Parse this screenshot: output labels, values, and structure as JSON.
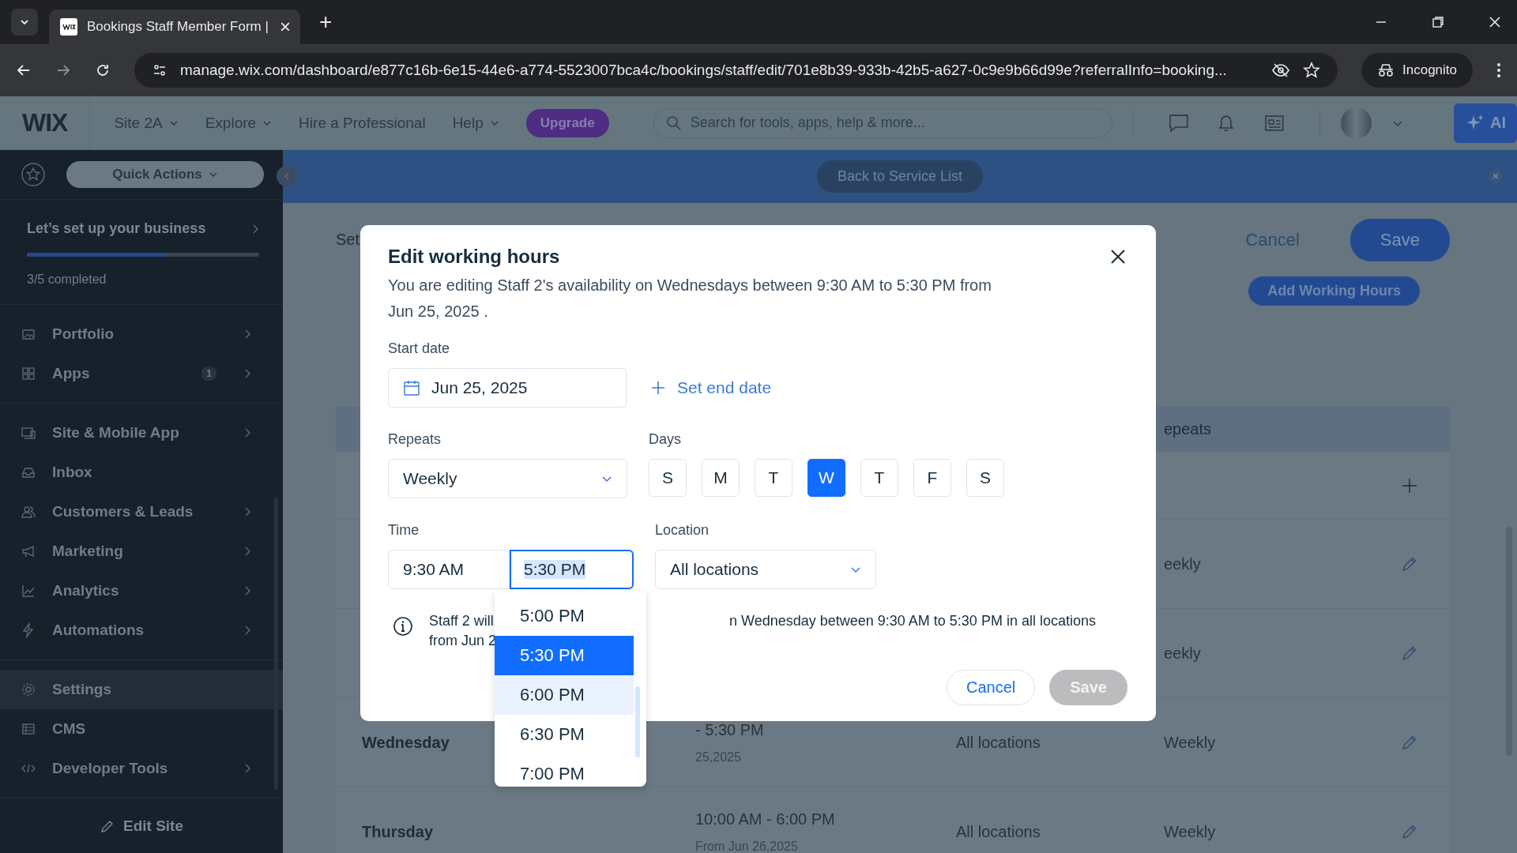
{
  "browser": {
    "tab": {
      "title": "Bookings Staff Member Form |",
      "close": "×"
    },
    "new_tab": "+",
    "url": "manage.wix.com/dashboard/e877c16b-6e15-44e6-a774-5523007bca4c/bookings/staff/edit/701e8b39-933b-42b5-a627-0c9e9b66d99e?referralInfo=booking...",
    "profile": "Incognito"
  },
  "topbar": {
    "logo": "WIX",
    "nav": [
      {
        "label": "Site 2A",
        "dropdown": true
      },
      {
        "label": "Explore",
        "dropdown": true
      },
      {
        "label": "Hire a Professional",
        "dropdown": false
      },
      {
        "label": "Help",
        "dropdown": true
      }
    ],
    "upgrade": "Upgrade",
    "search_placeholder": "Search for tools, apps, help & more...",
    "ai": "AI"
  },
  "sidebar": {
    "quick_actions": "Quick Actions",
    "setup": {
      "title": "Let’s set up your business",
      "progress": "3/5 completed",
      "level": 0.6
    },
    "sections": [
      {
        "items": [
          {
            "label": "Portfolio",
            "arrow": true,
            "selected": false
          },
          {
            "label": "Apps",
            "badge": "1",
            "arrow": true,
            "selected": false
          }
        ]
      },
      {
        "items": [
          {
            "label": "Site & Mobile App",
            "arrow": true,
            "selected": false
          },
          {
            "label": "Inbox",
            "arrow": false,
            "selected": false
          },
          {
            "label": "Customers & Leads",
            "arrow": true,
            "selected": false
          },
          {
            "label": "Marketing",
            "arrow": true,
            "selected": false
          },
          {
            "label": "Analytics",
            "arrow": true,
            "selected": false
          },
          {
            "label": "Automations",
            "arrow": true,
            "selected": false
          }
        ]
      },
      {
        "items": [
          {
            "label": "Settings",
            "arrow": false,
            "selected": true
          },
          {
            "label": "CMS",
            "arrow": false,
            "selected": false
          },
          {
            "label": "Developer Tools",
            "arrow": true,
            "selected": false
          }
        ]
      }
    ],
    "edit_site": "Edit Site"
  },
  "banner": {
    "button": "Back to Service List"
  },
  "page": {
    "title": "Set",
    "cancel": "Cancel",
    "save": "Save",
    "add_button": "Add Working Hours",
    "table": {
      "header": "epeats",
      "rows": [
        {
          "kind": "add"
        },
        {
          "kind": "entry",
          "repeats": "eekly"
        },
        {
          "kind": "entry",
          "repeats": "eekly"
        },
        {
          "kind": "entry",
          "day": "Wednesday",
          "time": "- 5:30 PM",
          "date": "25,2025",
          "location": "All locations",
          "repeats": "Weekly"
        },
        {
          "kind": "entry",
          "day": "Thursday",
          "time": "10:00 AM - 6:00 PM",
          "date": "From Jun 26,2025",
          "location": "All locations",
          "repeats": "Weekly"
        }
      ]
    }
  },
  "modal": {
    "title": "Edit working hours",
    "description": "You are editing Staff 2's availability on Wednesdays between 9:30 AM to 5:30 PM from Jun 25, 2025 .",
    "start_date": {
      "label": "Start date",
      "value": "Jun 25, 2025"
    },
    "set_end_date": "Set end date",
    "repeats": {
      "label": "Repeats",
      "value": "Weekly"
    },
    "days_label": "Days",
    "days": [
      {
        "label": "S",
        "selected": false
      },
      {
        "label": "M",
        "selected": false
      },
      {
        "label": "T",
        "selected": false
      },
      {
        "label": "W",
        "selected": true
      },
      {
        "label": "T",
        "selected": false
      },
      {
        "label": "F",
        "selected": false
      },
      {
        "label": "S",
        "selected": false
      }
    ],
    "time": {
      "label": "Time",
      "start": "9:30 AM",
      "end": "5:30 PM"
    },
    "location": {
      "label": "Location",
      "value": "All locations"
    },
    "info": {
      "left": "Staff 2 will\nfrom Jun 2",
      "right": "n Wednesday between 9:30 AM to 5:30 PM in all locations"
    },
    "cancel": "Cancel",
    "save": {
      "label": "Save",
      "disabled": true
    },
    "options": [
      {
        "label": "5:00 PM",
        "selected": false,
        "hovered": false
      },
      {
        "label": "5:30 PM",
        "selected": true,
        "hovered": false
      },
      {
        "label": "6:00 PM",
        "selected": false,
        "hovered": true
      },
      {
        "label": "6:30 PM",
        "selected": false,
        "hovered": false
      },
      {
        "label": "7:00 PM",
        "selected": false,
        "hovered": false
      }
    ]
  }
}
